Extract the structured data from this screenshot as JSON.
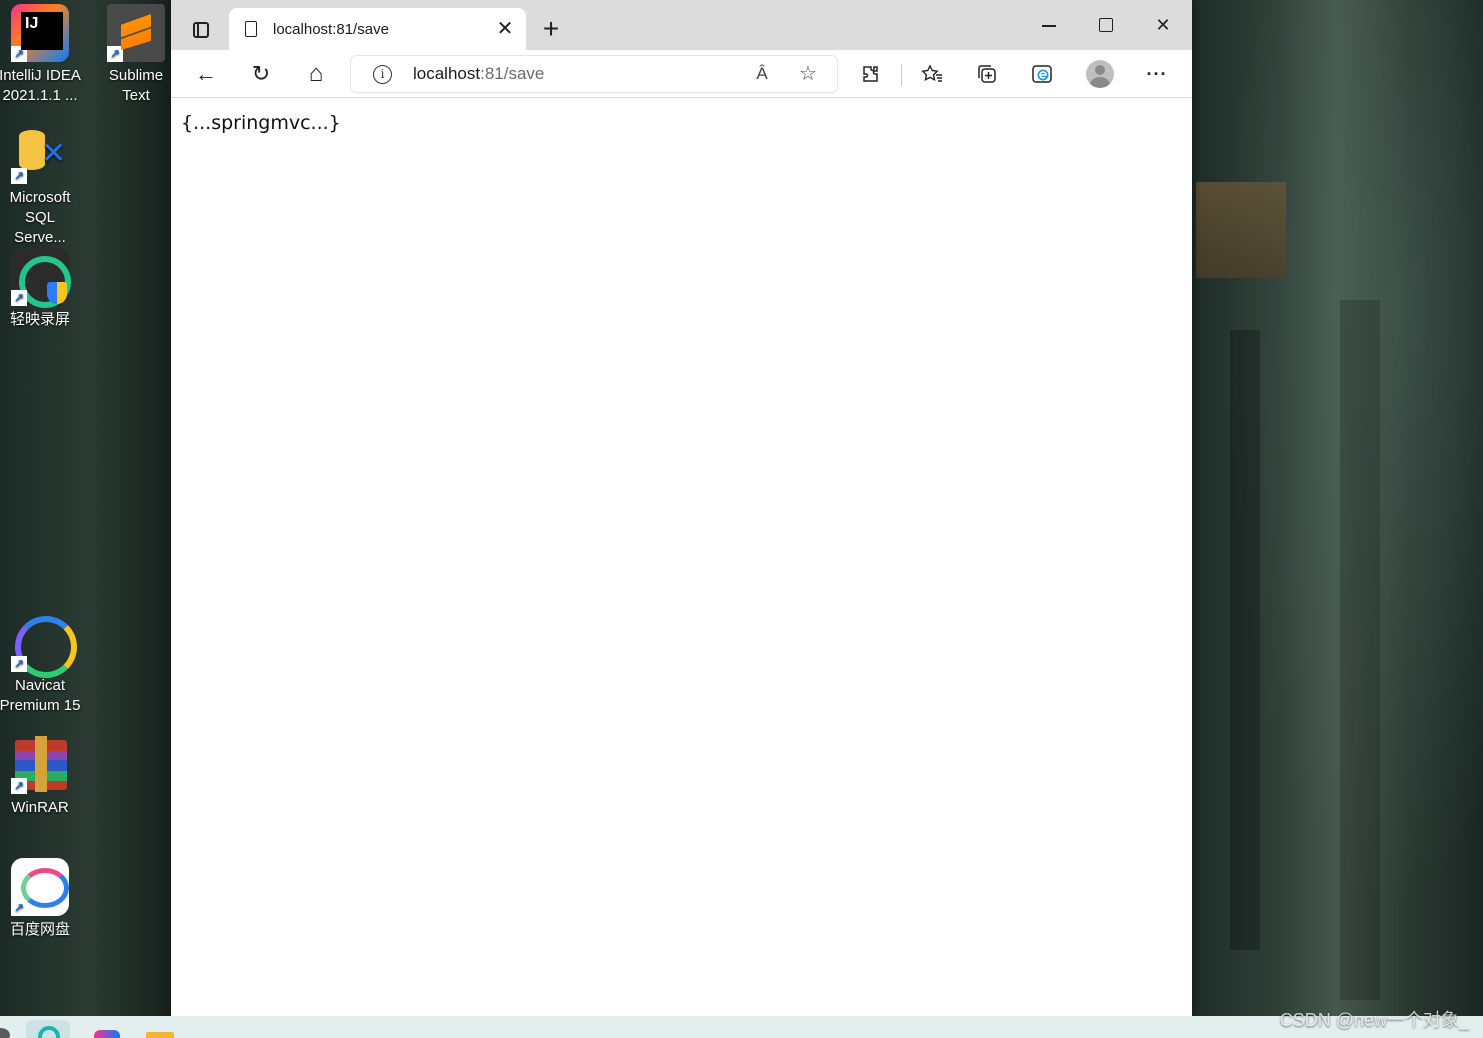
{
  "desktop": {
    "icons": [
      {
        "name": "IntelliJ IDEA",
        "label": "IntelliJ IDEA 2021.1.1 ..."
      },
      {
        "name": "Sublime Text",
        "label": "Sublime Text"
      },
      {
        "name": "Microsoft SQL Server",
        "label": "Microsoft SQL Serve..."
      },
      {
        "name": "轻映录屏",
        "label": "轻映录屏"
      },
      {
        "name": "Navicat Premium 15",
        "label": "Navicat Premium 15"
      },
      {
        "name": "WinRAR",
        "label": "WinRAR"
      },
      {
        "name": "百度网盘",
        "label": "百度网盘"
      }
    ]
  },
  "browser": {
    "tab": {
      "title": "localhost:81/save",
      "close_glyph": "✕"
    },
    "new_tab_glyph": "+",
    "window_controls": {
      "close_glyph": "✕"
    },
    "toolbar": {
      "back_glyph": "←",
      "refresh_glyph": "↻",
      "home_glyph": "⌂",
      "more_glyph": "···"
    },
    "address": {
      "info_glyph": "i",
      "host": "localhost",
      "rest": ":81/save",
      "read_aloud_glyph": "Â",
      "add_favorite_glyph": "☆"
    },
    "page": {
      "body_text": "{...springmvc...}"
    }
  },
  "watermark": "CSDN @new一个对象_",
  "colors": {
    "tabbar_bg": "#dcdcdc",
    "taskbar_bg": "#e3efef",
    "edge_blue": "#1a9fd9"
  },
  "icons": [
    "tab-actions-icon",
    "file-icon",
    "close-icon",
    "plus-icon",
    "minimize-icon",
    "maximize-icon",
    "back-icon",
    "refresh-icon",
    "home-icon",
    "info-icon",
    "read-aloud-icon",
    "add-favorite-icon",
    "extensions-icon",
    "favorites-icon",
    "collections-icon",
    "edge-icon",
    "profile-icon",
    "more-icon"
  ]
}
